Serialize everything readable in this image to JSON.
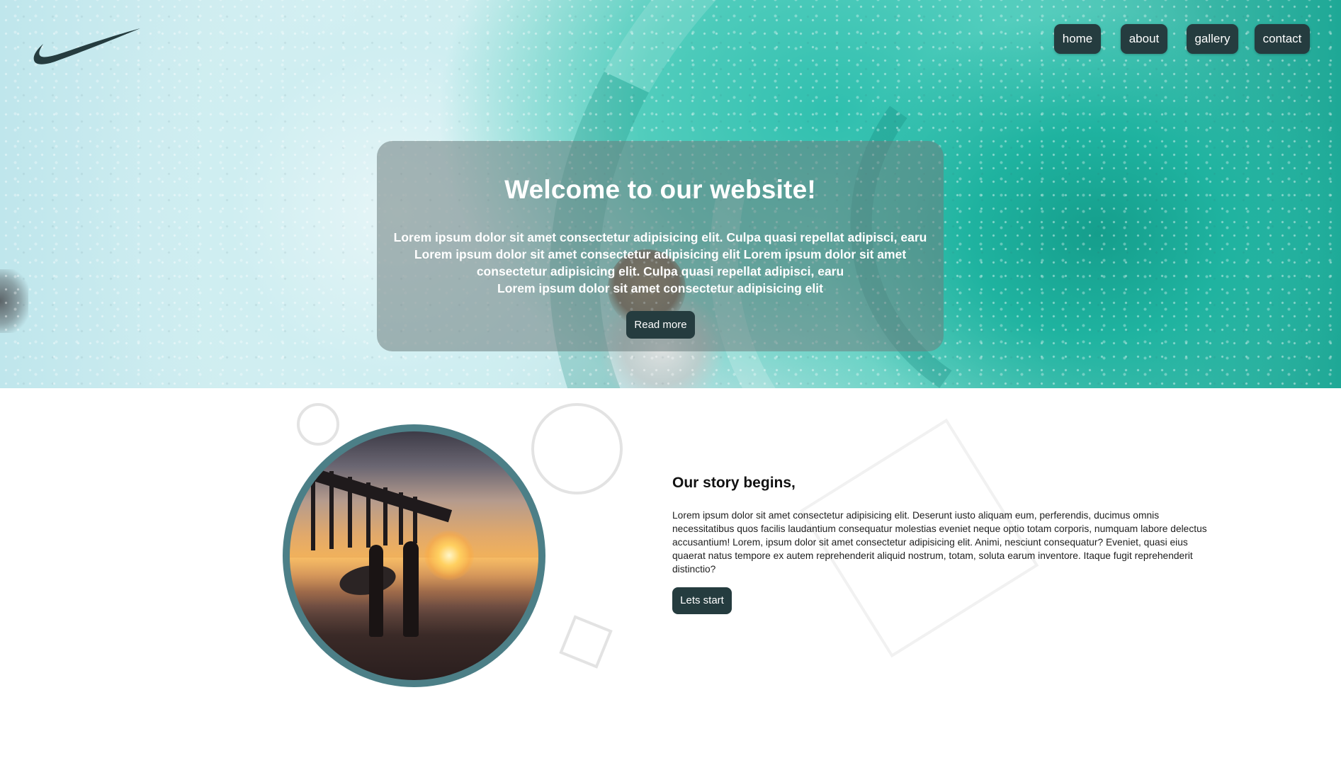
{
  "nav": {
    "items": [
      {
        "label": "home"
      },
      {
        "label": "about"
      },
      {
        "label": "gallery"
      },
      {
        "label": "contact"
      }
    ]
  },
  "logo": {
    "icon": "swoosh-logo",
    "color": "#253c3f"
  },
  "hero": {
    "title": "Welcome to our website!",
    "lines": [
      "Lorem ipsum dolor sit amet consectetur adipisicing elit. Culpa quasi repellat adipisci, earu",
      "Lorem ipsum dolor sit amet consectetur adipisicing elit Lorem ipsum dolor sit amet",
      "consectetur adipisicing elit. Culpa quasi repellat adipisci, earu",
      "Lorem ipsum dolor sit amet consectetur adipisicing elit"
    ],
    "button_label": "Read more"
  },
  "story": {
    "title": "Our story begins,",
    "text": "Lorem ipsum dolor sit amet consectetur adipisicing elit. Deserunt iusto aliquam eum, perferendis, ducimus omnis necessitatibus quos facilis laudantium consequatur molestias eveniet neque optio totam corporis, numquam labore delectus accusantium! Lorem, ipsum dolor sit amet consectetur adipisicing elit. Animi, nesciunt consequatur? Eveniet, quasi eius quaerat natus tempore ex autem reprehenderit aliquid nostrum, totam, soluta earum inventore. Itaque fugit reprehenderit distinctio?",
    "button_label": "Lets start"
  },
  "colors": {
    "primary_dark": "#253c3f",
    "ring": "#4c7f87",
    "decor": "#e3e3e3"
  }
}
